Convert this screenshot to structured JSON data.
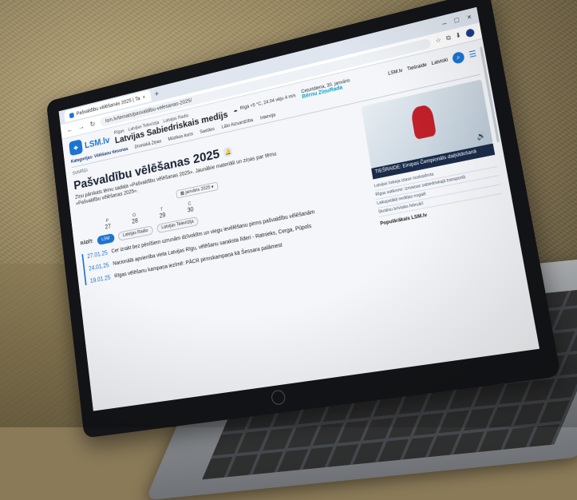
{
  "browser": {
    "tab_title": "Pašvaldību vēlēšanas 2025 | Ta",
    "new_tab": "+",
    "url": "lsm.lv/temats/pasvaldibu-velesanas-2025/",
    "window_controls": [
      "–",
      "□",
      "×"
    ]
  },
  "site": {
    "logo_text": "LSM.lv",
    "top_links": [
      "Rīgas",
      "Latvijas Televīzija",
      "Latvijas Radio"
    ],
    "site_name": "Latvijas Sabiedriskais medijs",
    "weather": "Rīgā +5 °C, 24.04 vēju 4 m/s",
    "date_line": "Ceturtdiena, 30. janvāris",
    "brand_pill": "Bērnu ZiņuRada",
    "header_right_links": [
      "LSM.lv",
      "Tiešraide",
      "Latviski"
    ],
    "subnav_strong": "Kategorijas: Vēlēšanu tiesonas",
    "subnav_items": [
      "Droniskā Ziņas",
      "Mūzikas kursi",
      "Sastāvs",
      "Lāto Aizsardzība",
      "Intervija"
    ]
  },
  "topic": {
    "crumb": "SVARĪGI",
    "title": "Pašvaldību vēlēšanas 2025",
    "description": "Ziņu pārskats tēmu sadaļa «Pašvaldību vēlēšanas 2025». Jaunākie materiāli un ziņas par tēmu «Pašvaldību vēlēšanas 2025».",
    "date_picker": "janvāris 2025",
    "days": [
      {
        "name": "P",
        "num": "27"
      },
      {
        "name": "O",
        "num": "28"
      },
      {
        "name": "T",
        "num": "29"
      },
      {
        "name": "C",
        "num": "30"
      }
    ],
    "source_label": "RĀDĪT:",
    "sources": [
      "LSM",
      "Latvijas Radio",
      "Latvijas Televīzija"
    ]
  },
  "news": [
    {
      "date": "27.01.25",
      "text": "Cer izrakt bez pēnīšiem uzrunām dzīvoklīm un viegu ievēlēšanu pirms pašvaldību vēlēšanām"
    },
    {
      "date": "24.01.25",
      "text": "Nacionālā apvienība vieta Latvijas Rīgu, vēlēšanu saraksta līderi - Ratnieks, Cerga, Pūpols"
    },
    {
      "date": "19.01.25",
      "text": "Rīgas vēlēšanu kampaņa iezīmē: PĀCR pirmskampaņa kā Šessara palāmest"
    }
  ],
  "aside": {
    "video_caption": "TIEŠRAIDE: Eiropas Čempionāts daiļslidošanā",
    "items": [
      "Latvijas hokeja izlase noskaidrota",
      "Rīgas satiksme: izmaiņas sabiedriskajā transportā",
      "Laikapstākļi nedēļas nogalē",
      "Skolēnu brīvlaiks februārī"
    ],
    "heading": "Populārākais LSM.lv"
  },
  "icons": {
    "logo": "map-pin-icon",
    "search": "search-icon",
    "menu": "hamburger-menu-icon",
    "bell": "bell-icon",
    "play": "volume-icon"
  },
  "colors": {
    "brand_blue": "#1c74d2",
    "dark_navy": "#1b2c4a",
    "sofa": "#9a8a61"
  }
}
